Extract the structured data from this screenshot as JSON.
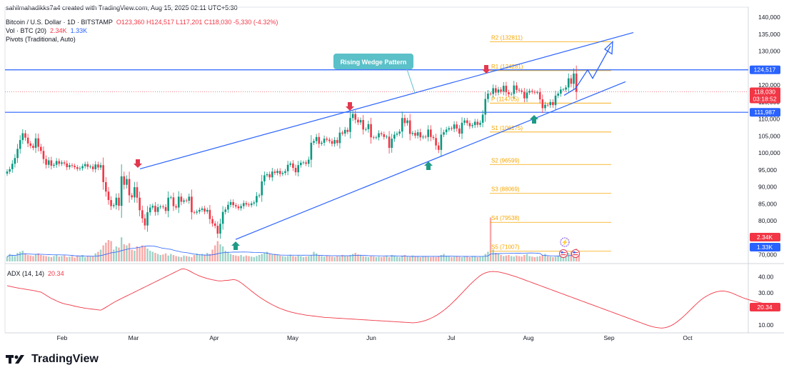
{
  "header": {
    "credit": "sahilmahadikks7a4 created with TradingView.com, Aug 15, 2025 02:11 UTC+5:30",
    "symbol": "Bitcoin / U.S. Dollar · 1D · BITSTAMP",
    "ohlc": {
      "o": "O123,360",
      "h": "H124,517",
      "l": "L117,201",
      "c": "C118,030",
      "chg": "-5,330 (-4.32%)"
    },
    "vol_label": "Vol · BTC (20)",
    "vol_v1": "2.34K",
    "vol_v2": "1.33K",
    "pivots_label": "Pivots (Traditional, Auto)",
    "adx_label": "ADX (14, 14)",
    "adx_value": "20.34"
  },
  "footer": {
    "brand": "TradingView"
  },
  "colors": {
    "up": "#089981",
    "down": "#f23645",
    "line_blue": "#2962ff",
    "pivot": "#f7a600",
    "adx": "#f23645",
    "vol_ma": "#2962ff"
  },
  "chart_data": {
    "type": "candlestick",
    "annotation": "Rising Wedge Pattern",
    "x_ticks": [
      "Feb",
      "Mar",
      "Apr",
      "May",
      "Jun",
      "Jul",
      "Aug",
      "Sep",
      "Oct"
    ],
    "y_ticks": [
      "140,000",
      "135,000",
      "130,000",
      "125,000",
      "120,000",
      "115,000",
      "110,000",
      "105,000",
      "100,000",
      "95,000",
      "90,000",
      "85,000",
      "80,000",
      "75,000",
      "70,000"
    ],
    "ylim": [
      68000,
      143000
    ],
    "price_badges": {
      "high": "124,517",
      "last": "118,030",
      "countdown": "03:18:52",
      "support": "111,987",
      "vol1": "2.34K",
      "vol2": "1.33K",
      "adx": "20.34"
    },
    "horizontal_levels": {
      "resistance": 124517,
      "support": 111987,
      "last": 118030
    },
    "pivots": [
      {
        "label": "R2 (132811)",
        "value": 132811
      },
      {
        "label": "R1 (124281)",
        "value": 124281
      },
      {
        "label": "P (114705)",
        "value": 114705
      },
      {
        "label": "S1 (106175)",
        "value": 106175
      },
      {
        "label": "S2 (96599)",
        "value": 96599
      },
      {
        "label": "S3 (88069)",
        "value": 88069
      },
      {
        "label": "S4 (79538)",
        "value": 79538
      },
      {
        "label": "S5 (71007)",
        "value": 71007
      }
    ],
    "adx_ticks": [
      "40.00",
      "30.00",
      "20.00",
      "10.00"
    ],
    "adx_ylim": [
      5,
      47
    ],
    "closes": [
      94500,
      95200,
      96800,
      98500,
      101200,
      103800,
      105800,
      104500,
      102800,
      102100,
      101500,
      104300,
      101800,
      100600,
      98200,
      96500,
      97800,
      96200,
      96500,
      97600,
      96800,
      97200,
      96900,
      95800,
      96400,
      96200,
      95800,
      95300,
      95500,
      96100,
      96700,
      95900,
      96000,
      95200,
      96600,
      95700,
      96400,
      91400,
      88600,
      86100,
      84300,
      84600,
      86800,
      84400,
      93100,
      90600,
      92300,
      87500,
      86900,
      89900,
      86800,
      83100,
      80700,
      78600,
      82500,
      83900,
      84400,
      82600,
      84000,
      84200,
      84000,
      82900,
      86800,
      86900,
      84300,
      83900,
      87100,
      85600,
      86000,
      85900,
      87100,
      82500,
      82400,
      82700,
      83200,
      83600,
      82700,
      83200,
      80500,
      79200,
      78500,
      76200,
      79100,
      82600,
      83300,
      84700,
      85500,
      84600,
      84200,
      83700,
      84300,
      85200,
      84800,
      84600,
      85100,
      85400,
      87300,
      87500,
      91600,
      93400,
      93700,
      92800,
      94500,
      94100,
      94700,
      93800,
      94100,
      94600,
      96500,
      96900,
      95600,
      94300,
      96400,
      97100,
      97200,
      96800,
      98000,
      103000,
      103500,
      104700,
      102700,
      103000,
      104200,
      103900,
      103500,
      102700,
      103800,
      102900,
      106000,
      105700,
      106800,
      106200,
      110300,
      111500,
      109800,
      109000,
      109700,
      106900,
      107000,
      108500,
      104600,
      104500,
      104600,
      105800,
      105500,
      104700,
      104800,
      101500,
      104200,
      105400,
      105700,
      106300,
      110300,
      108800,
      109600,
      105600,
      105900,
      105100,
      106100,
      104600,
      104800,
      104700,
      106900,
      104700,
      104400,
      102200,
      100900,
      105400,
      106100,
      106900,
      107300,
      107100,
      108400,
      107200,
      105700,
      108900,
      109600,
      108800,
      107900,
      108200,
      109200,
      108300,
      108900,
      111300,
      115900,
      117500,
      117400,
      119100,
      117800,
      118700,
      118100,
      119800,
      117900,
      117300,
      117400,
      119900,
      118600,
      118400,
      118000,
      116100,
      117800,
      118300,
      118000,
      117800,
      117900,
      115800,
      113200,
      114200,
      114100,
      115000,
      114100,
      116900,
      117500,
      118700,
      118700,
      119300,
      122000,
      120400,
      123400,
      118030
    ],
    "adx": [
      34.5,
      34.1,
      33.8,
      33.4,
      33.1,
      32.8,
      32.6,
      32.3,
      32.0,
      31.8,
      31.5,
      31.2,
      30.8,
      30.5,
      29.5,
      28.5,
      27.5,
      26.5,
      25.8,
      25.0,
      24.3,
      23.7,
      23.2,
      22.8,
      22.5,
      22.1,
      21.7,
      21.4,
      21.0,
      20.7,
      20.4,
      20.2,
      20.0,
      19.8,
      19.6,
      19.4,
      19.2,
      20.0,
      21.0,
      22.0,
      23.0,
      24.0,
      24.9,
      25.7,
      26.5,
      27.3,
      28.1,
      28.9,
      29.7,
      30.5,
      31.3,
      32.1,
      32.9,
      33.7,
      34.5,
      35.3,
      36.1,
      36.9,
      37.7,
      38.5,
      39.3,
      40.1,
      40.9,
      41.7,
      42.5,
      43.3,
      44.1,
      44.9,
      45.0,
      44.6,
      43.9,
      43.0,
      42.1,
      41.3,
      40.6,
      40.0,
      39.5,
      39.0,
      38.6,
      38.2,
      37.9,
      37.6,
      37.5,
      37.6,
      37.8,
      37.9,
      38.1,
      38.3,
      38.1,
      37.4,
      36.3,
      35.1,
      33.8,
      32.5,
      31.2,
      29.9,
      28.7,
      27.5,
      26.4,
      25.4,
      24.4,
      23.5,
      22.6,
      21.8,
      21.0,
      20.3,
      19.7,
      19.1,
      18.6,
      18.1,
      17.7,
      17.3,
      17.0,
      16.7,
      16.4,
      16.1,
      15.9,
      15.7,
      15.5,
      15.3,
      15.1,
      14.9,
      14.7,
      14.6,
      14.5,
      14.4,
      14.3,
      14.2,
      14.1,
      14.0,
      13.9,
      13.8,
      13.7,
      13.6,
      13.5,
      13.4,
      13.3,
      13.2,
      13.1,
      13.0,
      12.9,
      12.8,
      12.7,
      12.6,
      12.5,
      12.4,
      12.3,
      12.2,
      12.1,
      12.0,
      11.9,
      11.8,
      11.7,
      11.6,
      11.5,
      11.4,
      11.3,
      11.4,
      11.6,
      11.9,
      12.3,
      12.8,
      13.4,
      14.1,
      14.9,
      15.8,
      16.8,
      17.9,
      19.1,
      20.4,
      21.8,
      23.3,
      24.9,
      26.5,
      28.2,
      29.9,
      31.6,
      33.3,
      35.0,
      36.6,
      38.1,
      39.5,
      40.8,
      41.8,
      42.5,
      43.0,
      43.3,
      43.4,
      43.3,
      43.1,
      42.8,
      42.4,
      42.0,
      41.5,
      41.0,
      40.5,
      40.0,
      39.4,
      38.8,
      38.2,
      37.6,
      37.0,
      36.4,
      35.8,
      35.2,
      34.6,
      34.0,
      33.4,
      32.8,
      32.2,
      31.6,
      31.0,
      30.4,
      29.8,
      29.2,
      28.6,
      28.0,
      27.4,
      26.8,
      26.2,
      25.6,
      25.0,
      24.4,
      23.8,
      23.2,
      22.6,
      22.0,
      21.4,
      20.8,
      20.2,
      19.6,
      19.0,
      18.4,
      17.8,
      17.2,
      16.6,
      16.0,
      15.4,
      14.8,
      14.2,
      13.6,
      13.0,
      12.4,
      11.8,
      11.2,
      10.6,
      10.0,
      9.5,
      9.0,
      8.6,
      8.3,
      8.1,
      8.0,
      8.2,
      8.6,
      9.2,
      10.0,
      11.0,
      12.2,
      13.5,
      14.9,
      16.4,
      18.0,
      19.6,
      21.2,
      22.8,
      24.3,
      25.7,
      26.9,
      27.9,
      28.8,
      29.6,
      30.2,
      30.7,
      31.0,
      31.2,
      31.1,
      30.8,
      30.4,
      29.8,
      29.1,
      28.4,
      27.7,
      27.0,
      26.4,
      25.9,
      25.4,
      25.0,
      24.6,
      24.2,
      23.8,
      23.4,
      22.9,
      22.3,
      21.6,
      20.34
    ],
    "volume": [
      9,
      14,
      12,
      10,
      16,
      18,
      20,
      15,
      12,
      11,
      10,
      13,
      15,
      12,
      11,
      10,
      9,
      8,
      10,
      12,
      9,
      10,
      11,
      8,
      9,
      10,
      7,
      11,
      9,
      12,
      8,
      10,
      9,
      10,
      15,
      18,
      22,
      30,
      35,
      40,
      38,
      22,
      28,
      26,
      45,
      32,
      30,
      34,
      22,
      20,
      28,
      26,
      30,
      28,
      24,
      20,
      18,
      16,
      14,
      12,
      13,
      15,
      11,
      14,
      12,
      10,
      9,
      8,
      11,
      10,
      9,
      8,
      12,
      15,
      13,
      14,
      12,
      16,
      14,
      22,
      30,
      38,
      32,
      28,
      20,
      18,
      14,
      12,
      11,
      10,
      12,
      9,
      11,
      10,
      9,
      8,
      10,
      12,
      14,
      16,
      18,
      15,
      13,
      14,
      12,
      11,
      10,
      9,
      10,
      12,
      10,
      9,
      11,
      10,
      8,
      9,
      10,
      12,
      18,
      15,
      12,
      10,
      9,
      11,
      10,
      9,
      8,
      10,
      9,
      12,
      11,
      10,
      12,
      14,
      16,
      13,
      12,
      10,
      9,
      8,
      10,
      9,
      8,
      9,
      8,
      9,
      10,
      8,
      12,
      10,
      9,
      8,
      10,
      12,
      10,
      9,
      11,
      10,
      9,
      8,
      9,
      10,
      9,
      8,
      9,
      8,
      10,
      12,
      14,
      10,
      9,
      8,
      9,
      10,
      9,
      8,
      9,
      10,
      8,
      9,
      10,
      8,
      9,
      10,
      14,
      18,
      82,
      22,
      16,
      14,
      12,
      10,
      11,
      12,
      10,
      9,
      11,
      10,
      9,
      12,
      14,
      10,
      9,
      8,
      9,
      10,
      12,
      14,
      10,
      9,
      8,
      9,
      10,
      9,
      12,
      14,
      16,
      18,
      14,
      24,
      16
    ],
    "vol_ma_scale": 12
  }
}
